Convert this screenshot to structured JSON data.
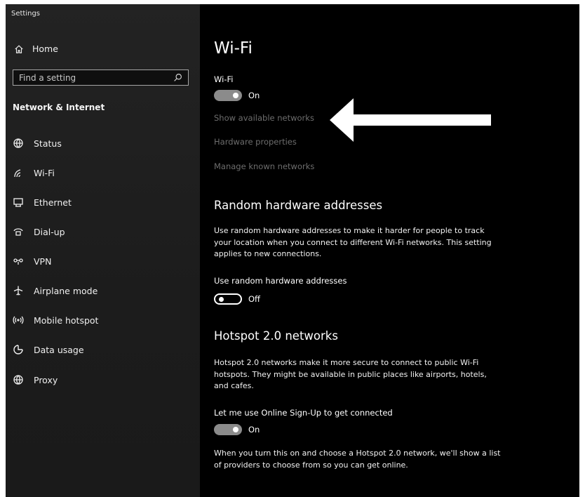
{
  "window": {
    "title": "Settings"
  },
  "sidebar": {
    "home_label": "Home",
    "search_placeholder": "Find a setting",
    "section_title": "Network & Internet",
    "items": [
      {
        "label": "Status",
        "icon": "globe-status-icon"
      },
      {
        "label": "Wi-Fi",
        "icon": "wifi-icon"
      },
      {
        "label": "Ethernet",
        "icon": "ethernet-icon"
      },
      {
        "label": "Dial-up",
        "icon": "dialup-icon"
      },
      {
        "label": "VPN",
        "icon": "vpn-icon"
      },
      {
        "label": "Airplane mode",
        "icon": "airplane-icon"
      },
      {
        "label": "Mobile hotspot",
        "icon": "hotspot-icon"
      },
      {
        "label": "Data usage",
        "icon": "data-usage-icon"
      },
      {
        "label": "Proxy",
        "icon": "globe-icon"
      }
    ]
  },
  "main": {
    "title": "Wi-Fi",
    "wifi": {
      "label": "Wi-Fi",
      "toggle_state": "On",
      "on": true
    },
    "links": {
      "show_networks": "Show available networks",
      "hardware_properties": "Hardware properties",
      "manage_known": "Manage known networks"
    },
    "random_hw": {
      "heading": "Random hardware addresses",
      "description": "Use random hardware addresses to make it harder for people to track your location when you connect to different Wi-Fi networks. This setting applies to new connections.",
      "toggle_label": "Use random hardware addresses",
      "toggle_state": "Off",
      "on": false
    },
    "hotspot": {
      "heading": "Hotspot 2.0 networks",
      "description": "Hotspot 2.0 networks make it more secure to connect to public Wi-Fi hotspots. They might be available in public places like airports, hotels, and cafes.",
      "toggle_label": "Let me use Online Sign-Up to get connected",
      "toggle_state": "On",
      "on": true,
      "footer": "When you turn this on and choose a Hotspot 2.0 network, we'll show a list of providers to choose from so you can get online."
    }
  },
  "colors": {
    "sidebar_bg": "#1f1f1f",
    "content_bg": "#000000",
    "link": "#6d6d6d",
    "toggle_on": "#8b8b8b",
    "annotation_arrow": "#ffffff"
  }
}
